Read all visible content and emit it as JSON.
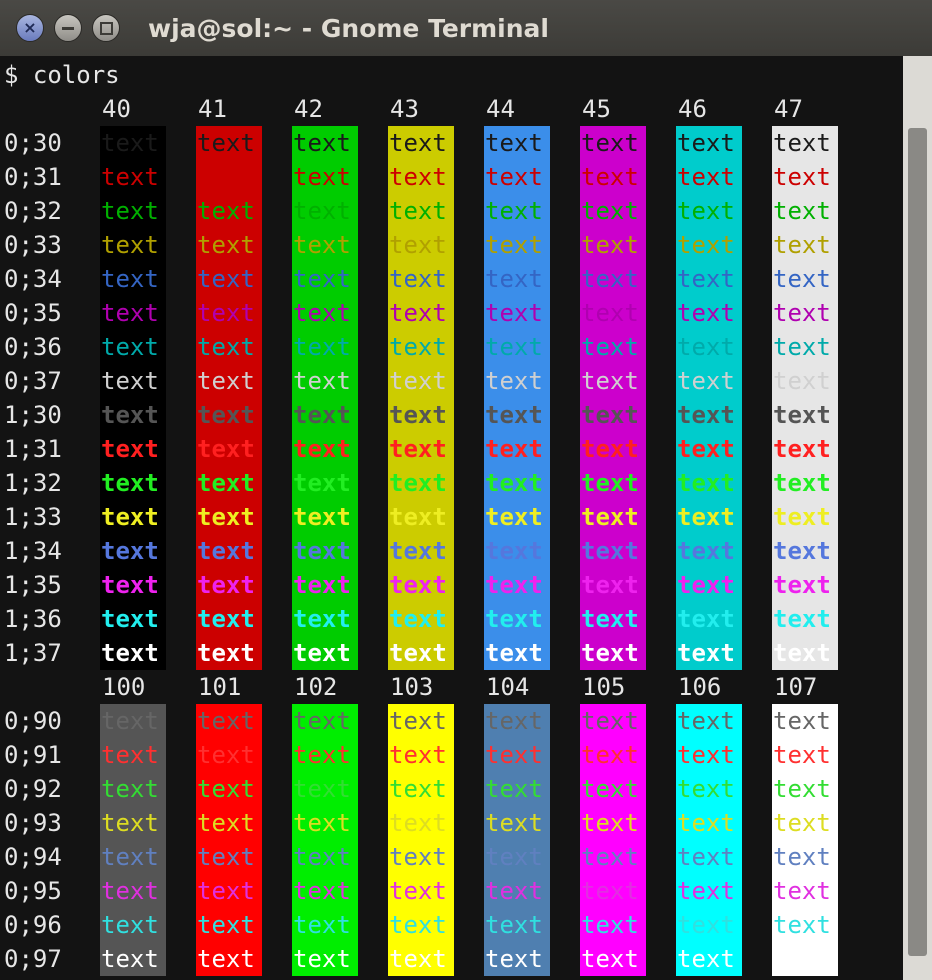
{
  "window": {
    "title": "wja@sol:~ - Gnome Terminal",
    "close_glyph": "×",
    "minimize_glyph": "",
    "maximize_glyph": ""
  },
  "terminal": {
    "prompt": "$ colors",
    "cell_text": "text",
    "section1": {
      "headers": [
        "40",
        "41",
        "42",
        "43",
        "44",
        "45",
        "46",
        "47"
      ],
      "bg_colors": [
        "#000000",
        "#cc0000",
        "#00cc00",
        "#cccc00",
        "#3b8eea",
        "#cc00cc",
        "#00cccc",
        "#e6e6e6"
      ],
      "rows": [
        "0;30",
        "0;31",
        "0;32",
        "0;33",
        "0;34",
        "0;35",
        "0;36",
        "0;37",
        "1;30",
        "1;31",
        "1;32",
        "1;33",
        "1;34",
        "1;35",
        "1;36",
        "1;37"
      ]
    },
    "section2": {
      "headers": [
        "100",
        "101",
        "102",
        "103",
        "104",
        "105",
        "106",
        "107"
      ],
      "bg_colors": [
        "#555555",
        "#ff0000",
        "#00ee00",
        "#ffff00",
        "#4f7fb0",
        "#ff00ff",
        "#00ffff",
        "#ffffff"
      ],
      "rows": [
        "0;90",
        "0;91",
        "0;92",
        "0;93",
        "0;94",
        "0;95",
        "0;96",
        "0;97"
      ]
    },
    "fg_colors": {
      "30": "#1a1a1a",
      "31": "#cc0000",
      "32": "#00b000",
      "33": "#b0a000",
      "34": "#3465c4",
      "35": "#b000b0",
      "36": "#00aaaa",
      "37": "#d0d0d0",
      "b30": "#555555",
      "b31": "#ff2020",
      "b32": "#22ee22",
      "b33": "#eeee22",
      "b34": "#5577dd",
      "b35": "#ee22ee",
      "b36": "#22eeee",
      "b37": "#ffffff",
      "90": "#666666",
      "91": "#ff3030",
      "92": "#33dd33",
      "93": "#dddd22",
      "94": "#6080c0",
      "95": "#e030e0",
      "96": "#30e0e0",
      "97": "#ffffff"
    }
  }
}
